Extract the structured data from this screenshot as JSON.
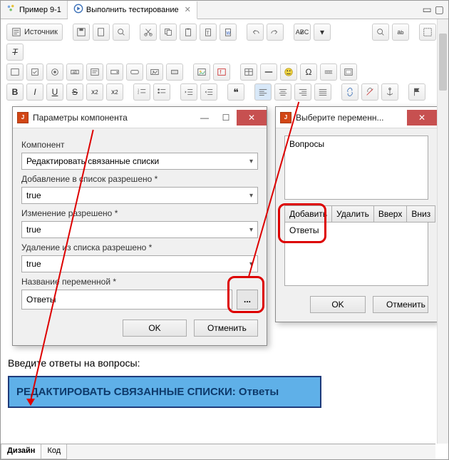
{
  "tabs": [
    {
      "label": "Пример 9-1"
    },
    {
      "label": "Выполнить тестирование"
    }
  ],
  "toolbar": {
    "source_label": "Источник"
  },
  "dialog1": {
    "title": "Параметры компонента",
    "labels": {
      "component": "Компонент",
      "add_allowed": "Добавление в список разрешено *",
      "edit_allowed": "Изменение разрешено *",
      "remove_allowed": "Удаление из списка разрешено *",
      "var_name": "Название переменной *"
    },
    "values": {
      "component": "Редактировать связанные списки",
      "add_allowed": "true",
      "edit_allowed": "true",
      "remove_allowed": "true",
      "var_name": "Ответы"
    },
    "buttons": {
      "ok": "OK",
      "cancel": "Отменить"
    }
  },
  "dialog2": {
    "title": "Выберите переменн...",
    "list1": [
      "Вопросы"
    ],
    "buttons_row": {
      "add": "Добавить",
      "del": "Удалить",
      "up": "Вверх",
      "down": "Вниз"
    },
    "list2": [
      "Ответы"
    ],
    "buttons": {
      "ok": "OK",
      "cancel": "Отменить"
    }
  },
  "editor": {
    "instruction": "Введите ответы на вопросы:",
    "banner": "РЕДАКТИРОВАТЬ СВЯЗАННЫЕ СПИСКИ: Ответы"
  },
  "bottom_tabs": {
    "design": "Дизайн",
    "code": "Код"
  }
}
